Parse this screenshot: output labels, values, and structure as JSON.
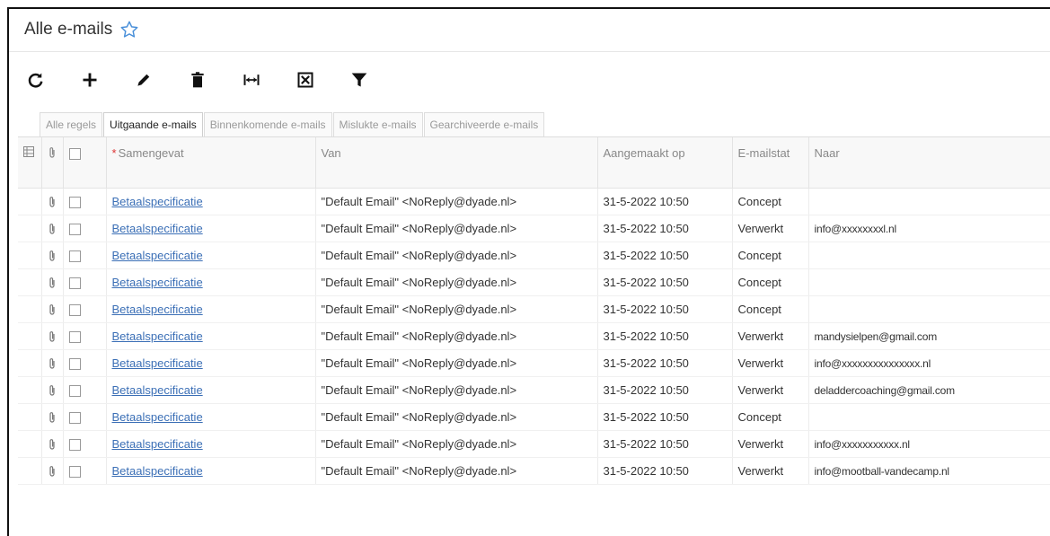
{
  "header": {
    "title": "Alle e-mails"
  },
  "toolbar": {
    "icons": [
      "refresh-icon",
      "plus-icon",
      "pencil-icon",
      "trash-icon",
      "column-width-icon",
      "clear-filter-icon",
      "filter-icon"
    ]
  },
  "tabs": [
    {
      "label": "Alle regels",
      "active": false
    },
    {
      "label": "Uitgaande e-mails",
      "active": true
    },
    {
      "label": "Binnenkomende e-mails",
      "active": false
    },
    {
      "label": "Mislukte e-mails",
      "active": false
    },
    {
      "label": "Gearchiveerde e-mails",
      "active": false
    }
  ],
  "table": {
    "headers": {
      "samenvatting": "Samengevat",
      "van": "Van",
      "aangemaakt": "Aangemaakt op",
      "status": "E-mailstat",
      "naar": "Naar"
    },
    "rows": [
      {
        "subject": "Betaalspecificatie",
        "from": "\"Default Email\" <NoReply@dyade.nl>",
        "created": "31-5-2022 10:50",
        "status": "Concept",
        "to": ""
      },
      {
        "subject": "Betaalspecificatie",
        "from": "\"Default Email\" <NoReply@dyade.nl>",
        "created": "31-5-2022 10:50",
        "status": "Verwerkt",
        "to": "info@xxxxxxxxl.nl"
      },
      {
        "subject": "Betaalspecificatie",
        "from": "\"Default Email\" <NoReply@dyade.nl>",
        "created": "31-5-2022 10:50",
        "status": "Concept",
        "to": ""
      },
      {
        "subject": "Betaalspecificatie",
        "from": "\"Default Email\" <NoReply@dyade.nl>",
        "created": "31-5-2022 10:50",
        "status": "Concept",
        "to": ""
      },
      {
        "subject": "Betaalspecificatie",
        "from": "\"Default Email\" <NoReply@dyade.nl>",
        "created": "31-5-2022 10:50",
        "status": "Concept",
        "to": ""
      },
      {
        "subject": "Betaalspecificatie",
        "from": "\"Default Email\" <NoReply@dyade.nl>",
        "created": "31-5-2022 10:50",
        "status": "Verwerkt",
        "to": "mandysielpen@gmail.com"
      },
      {
        "subject": "Betaalspecificatie",
        "from": "\"Default Email\" <NoReply@dyade.nl>",
        "created": "31-5-2022 10:50",
        "status": "Verwerkt",
        "to": "info@xxxxxxxxxxxxxxx.nl"
      },
      {
        "subject": "Betaalspecificatie",
        "from": "\"Default Email\" <NoReply@dyade.nl>",
        "created": "31-5-2022 10:50",
        "status": "Verwerkt",
        "to": "deladdercoaching@gmail.com"
      },
      {
        "subject": "Betaalspecificatie",
        "from": "\"Default Email\" <NoReply@dyade.nl>",
        "created": "31-5-2022 10:50",
        "status": "Concept",
        "to": ""
      },
      {
        "subject": "Betaalspecificatie",
        "from": "\"Default Email\" <NoReply@dyade.nl>",
        "created": "31-5-2022 10:50",
        "status": "Verwerkt",
        "to": "info@xxxxxxxxxxx.nl"
      },
      {
        "subject": "Betaalspecificatie",
        "from": "\"Default Email\" <NoReply@dyade.nl>",
        "created": "31-5-2022 10:50",
        "status": "Verwerkt",
        "to": "info@mootball-vandecamp.nl"
      }
    ]
  },
  "colors": {
    "link": "#3b6fb6",
    "star": "#4a90d9",
    "required": "#d33"
  }
}
